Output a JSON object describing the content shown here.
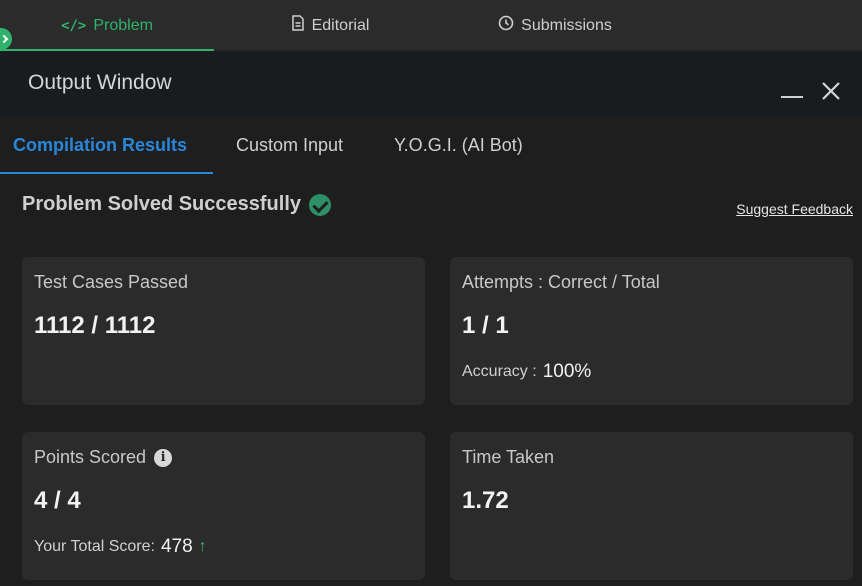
{
  "top_tabs": [
    {
      "label": "Problem",
      "icon": "code-icon",
      "active": true
    },
    {
      "label": "Editorial",
      "icon": "document-icon"
    },
    {
      "label": "Submissions",
      "icon": "clock-icon"
    }
  ],
  "output_window": {
    "title": "Output Window"
  },
  "inner_tabs": [
    {
      "label": "Compilation Results",
      "active": true
    },
    {
      "label": "Custom Input"
    },
    {
      "label": "Y.O.G.I. (AI Bot)"
    }
  ],
  "result": {
    "status": "Problem Solved Successfully",
    "feedback_link": "Suggest Feedback"
  },
  "cards": {
    "test_cases": {
      "label": "Test Cases Passed",
      "value": "1112 / 1112"
    },
    "attempts": {
      "label": "Attempts : Correct / Total",
      "value": "1 / 1",
      "sub_label": "Accuracy :",
      "sub_value": "100%"
    },
    "points": {
      "label": "Points Scored",
      "value": "4 / 4",
      "sub_label": "Your Total Score:",
      "sub_value": "478"
    },
    "time": {
      "label": "Time Taken",
      "value": "1.72"
    }
  },
  "colors": {
    "accent_green": "#2fb36a",
    "accent_blue": "#2a86d9",
    "card_bg": "#2b2b2b",
    "page_bg": "#1e1e1e"
  }
}
